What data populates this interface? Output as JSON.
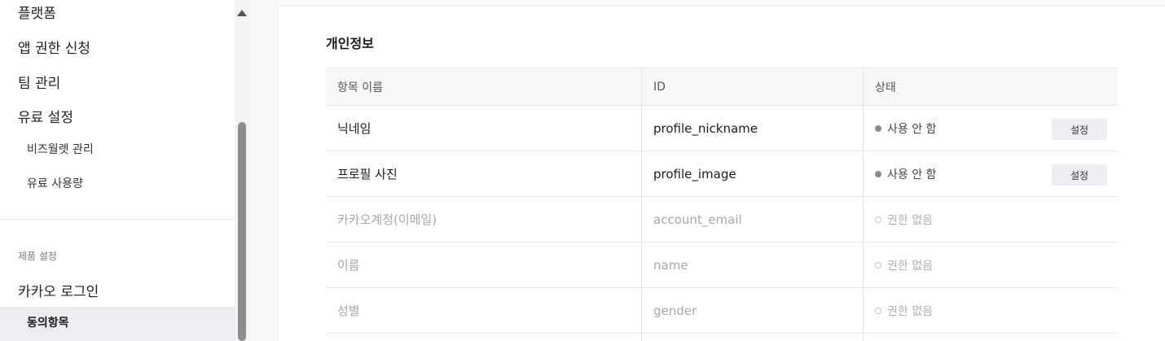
{
  "sidebar": {
    "items": [
      {
        "label": "플랫폼"
      },
      {
        "label": "앱 권한 신청"
      },
      {
        "label": "팀 관리"
      },
      {
        "label": "유료 설정"
      },
      {
        "label": "비즈월렛 관리"
      },
      {
        "label": "유료 사용량"
      }
    ],
    "section_label": "제품 설정",
    "product": {
      "label": "카카오 로그인"
    },
    "active_item": {
      "label": "동의항목"
    }
  },
  "main": {
    "section_title": "개인정보",
    "table": {
      "headers": [
        "항목 이름",
        "ID",
        "상태"
      ],
      "rows": [
        {
          "name": "닉네임",
          "id": "profile_nickname",
          "status": "사용 안 함",
          "button": "설정"
        },
        {
          "name": "프로필 사진",
          "id": "profile_image",
          "status": "사용 안 함",
          "button": "설정"
        },
        {
          "name": "카카오계정(이메일)",
          "id": "account_email",
          "status": "권한 없음"
        },
        {
          "name": "이름",
          "id": "name",
          "status": "권한 없음"
        },
        {
          "name": "성별",
          "id": "gender",
          "status": "권한 없음"
        }
      ]
    }
  },
  "icons": {
    "scroll_up": "triangle-up-icon",
    "status_enabled": "filled-circle-icon",
    "status_disabled": "hollow-circle-icon"
  },
  "colors": {
    "active_nav_bg": "#ecedf1",
    "table_header_bg": "#f6f7f8",
    "button_bg": "#eceef3",
    "disabled_text": "#a8a8a8"
  }
}
